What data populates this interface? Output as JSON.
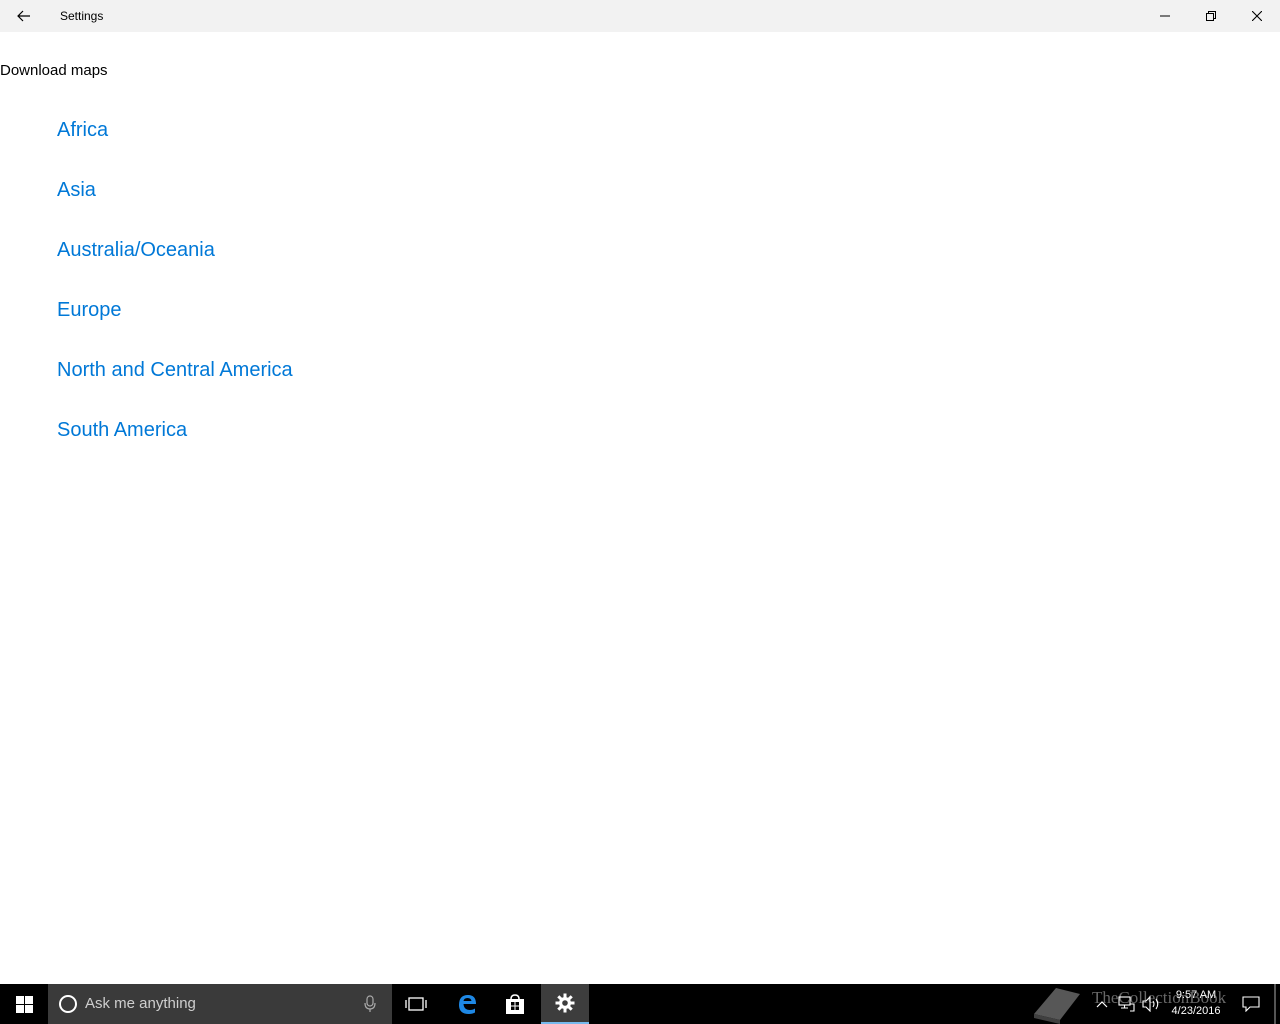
{
  "window": {
    "title": "Settings"
  },
  "page": {
    "heading": "Download maps",
    "regions": [
      {
        "label": "Africa"
      },
      {
        "label": "Asia"
      },
      {
        "label": "Australia/Oceania"
      },
      {
        "label": "Europe"
      },
      {
        "label": "North and Central America"
      },
      {
        "label": "South America"
      }
    ]
  },
  "taskbar": {
    "search_placeholder": "Ask me anything",
    "time": "9:57 AM",
    "date": "4/23/2016",
    "watermark": "TheCollectionBook"
  },
  "colors": {
    "accent": "#0078d7",
    "titlebar": "#f2f2f2",
    "taskbar": "#000000"
  },
  "icons": {
    "back": "back-arrow-icon",
    "minimize": "minimize-icon",
    "maximize": "restore-icon",
    "close": "close-icon",
    "start": "windows-logo-icon",
    "cortana": "cortana-circle-icon",
    "mic": "microphone-icon",
    "taskview": "task-view-icon",
    "edge": "edge-icon",
    "store": "store-icon",
    "settings": "gear-icon"
  }
}
